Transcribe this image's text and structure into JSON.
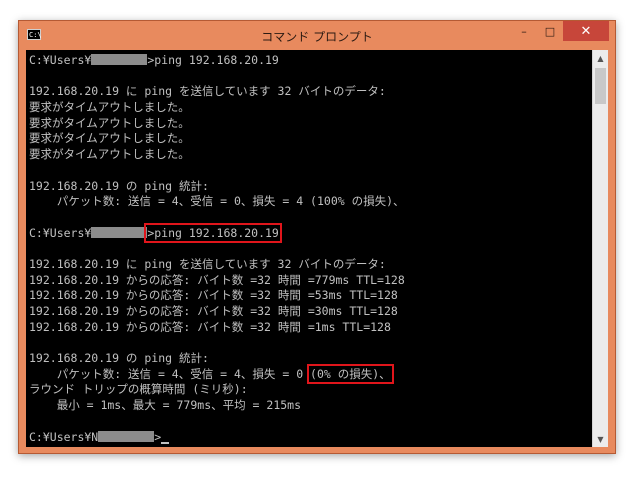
{
  "window": {
    "title": "コマンド プロンプト",
    "icon_label": "C:\\",
    "controls": {
      "minimize": "–",
      "maximize": "□",
      "close": "✕"
    }
  },
  "console": {
    "lines": [
      {
        "pre": "C:¥Users¥",
        "masked": true,
        "post": ">ping 192.168.20.19"
      },
      {
        "text": ""
      },
      {
        "text": "192.168.20.19 に ping を送信しています 32 バイトのデータ:"
      },
      {
        "text": "要求がタイムアウトしました。"
      },
      {
        "text": "要求がタイムアウトしました。"
      },
      {
        "text": "要求がタイムアウトしました。"
      },
      {
        "text": "要求がタイムアウトしました。"
      },
      {
        "text": ""
      },
      {
        "text": "192.168.20.19 の ping 統計:"
      },
      {
        "text": "    パケット数: 送信 = 4、受信 = 0、損失 = 4 (100% の損失)、"
      },
      {
        "text": ""
      },
      {
        "pre": "C:¥Users¥",
        "masked": true,
        "post_hl": ">ping 192.168.20.19"
      },
      {
        "text": ""
      },
      {
        "text": "192.168.20.19 に ping を送信しています 32 バイトのデータ:"
      },
      {
        "text": "192.168.20.19 からの応答: バイト数 =32 時間 =779ms TTL=128"
      },
      {
        "text": "192.168.20.19 からの応答: バイト数 =32 時間 =53ms TTL=128"
      },
      {
        "text": "192.168.20.19 からの応答: バイト数 =32 時間 =30ms TTL=128"
      },
      {
        "text": "192.168.20.19 からの応答: バイト数 =32 時間 =1ms TTL=128"
      },
      {
        "text": ""
      },
      {
        "text": "192.168.20.19 の ping 統計:"
      },
      {
        "text": "    パケット数: 送信 = 4、受信 = 4、損失 = 0 ",
        "hl_tail": "(0% の損失)、"
      },
      {
        "text": "ラウンド トリップの概算時間 (ミリ秒):"
      },
      {
        "text": "    最小 = 1ms、最大 = 779ms、平均 = 215ms"
      },
      {
        "text": ""
      },
      {
        "pre": "C:¥Users¥N",
        "masked": true,
        "post": ">",
        "cursor": true
      }
    ]
  },
  "scrollbar": {
    "up_icon": "▲",
    "down_icon": "▼"
  }
}
